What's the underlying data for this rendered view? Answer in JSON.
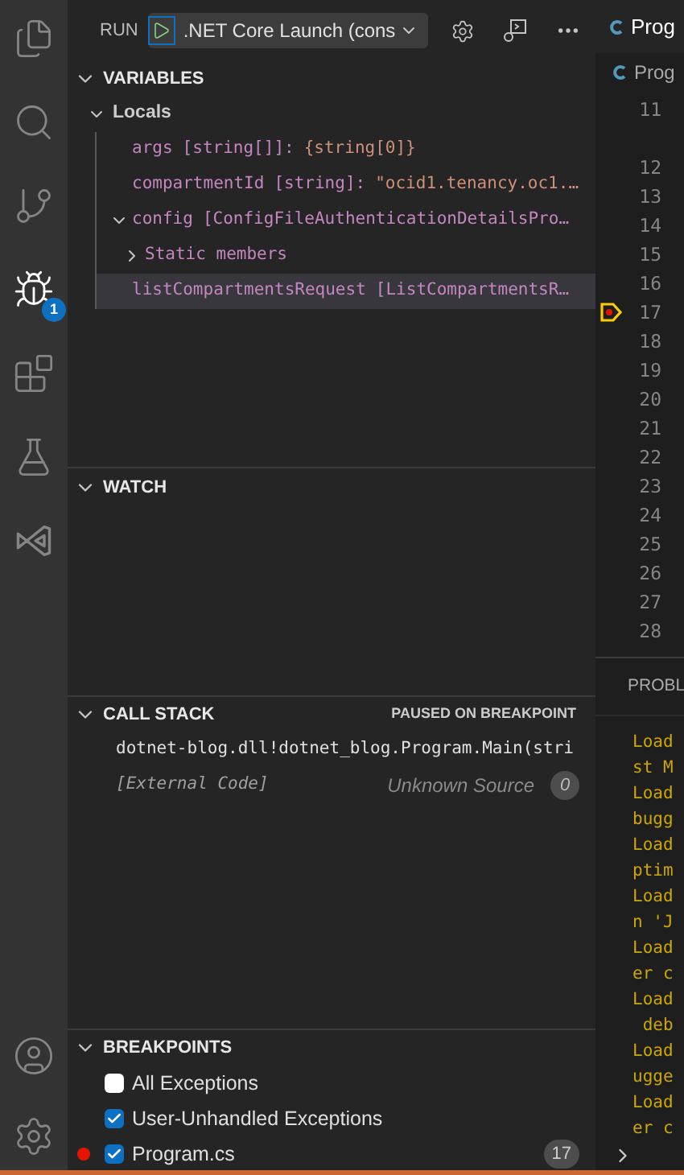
{
  "activity_bar": {
    "items": [
      {
        "selected": false
      },
      {
        "selected": false
      },
      {
        "selected": false
      },
      {
        "selected": true,
        "badge": "1"
      },
      {
        "selected": false
      },
      {
        "selected": false
      },
      {
        "selected": false
      }
    ],
    "bottom_items": [
      {
        "selected": false
      },
      {
        "selected": false
      }
    ]
  },
  "run_toolbar": {
    "label": "RUN",
    "configuration": ".NET Core Launch (cons"
  },
  "variables": {
    "title": "VARIABLES",
    "expanded": true,
    "scopes": [
      {
        "label": "Locals",
        "expanded": true,
        "children": [
          {
            "name": "args",
            "type": "[string[]]:",
            "value": "{string[0]}",
            "selected": false
          },
          {
            "name": "compartmentId",
            "type": "[string]:",
            "value": "\"ocid1.tenancy.oc1.…",
            "selected": false
          },
          {
            "name": "config",
            "type": "[ConfigFileAuthenticationDetailsPro…",
            "expanded": true,
            "selected": false,
            "children": [
              {
                "name": "Static members",
                "expanded": false,
                "selected": false
              }
            ]
          },
          {
            "name": "listCompartmentsRequest",
            "type": "[ListCompartmentsR…",
            "selected": true
          }
        ]
      }
    ]
  },
  "watch": {
    "title": "WATCH",
    "expanded": true
  },
  "call_stack": {
    "title": "CALL STACK",
    "expanded": true,
    "status": "PAUSED ON BREAKPOINT",
    "frames": [
      {
        "kind": "frame",
        "name": "dotnet-blog.dll!dotnet_blog.Program.Main(stri"
      },
      {
        "kind": "external",
        "name": "[External Code]",
        "source": "Unknown Source",
        "line": "0"
      }
    ]
  },
  "breakpoints": {
    "title": "BREAKPOINTS",
    "expanded": true,
    "items": [
      {
        "kind": "exception",
        "label": "All Exceptions",
        "checked": false
      },
      {
        "kind": "exception",
        "label": "User-Unhandled Exceptions",
        "checked": true
      },
      {
        "kind": "file",
        "label": "Program.cs",
        "checked": true,
        "line": "17"
      }
    ]
  },
  "editor": {
    "tab": "Prog",
    "breadcrumb": "Prog",
    "lines": [
      {
        "kind": "wrapped",
        "number": "11"
      },
      {
        "kind": "plain",
        "number": "12"
      },
      {
        "kind": "plain",
        "number": "13"
      },
      {
        "kind": "plain",
        "number": "14"
      },
      {
        "kind": "plain",
        "number": "15"
      },
      {
        "kind": "plain",
        "number": "16"
      },
      {
        "kind": "breakpoint",
        "number": "17"
      },
      {
        "kind": "plain",
        "number": "18"
      },
      {
        "kind": "plain",
        "number": "19"
      },
      {
        "kind": "plain",
        "number": "20"
      },
      {
        "kind": "plain",
        "number": "21"
      },
      {
        "kind": "plain",
        "number": "22"
      },
      {
        "kind": "plain",
        "number": "23"
      },
      {
        "kind": "plain",
        "number": "24"
      },
      {
        "kind": "plain",
        "number": "25"
      },
      {
        "kind": "plain",
        "number": "26"
      },
      {
        "kind": "plain",
        "number": "27"
      },
      {
        "kind": "plain",
        "number": "28"
      }
    ]
  },
  "panel": {
    "tab": "PROBL",
    "output": [
      "Load",
      "st M",
      "Load",
      "bugg",
      "Load",
      "ptim",
      "Load",
      "n 'J",
      "Load",
      "er c",
      "Load",
      " deb",
      "Load",
      "ugge",
      "Load",
      "er c"
    ]
  }
}
